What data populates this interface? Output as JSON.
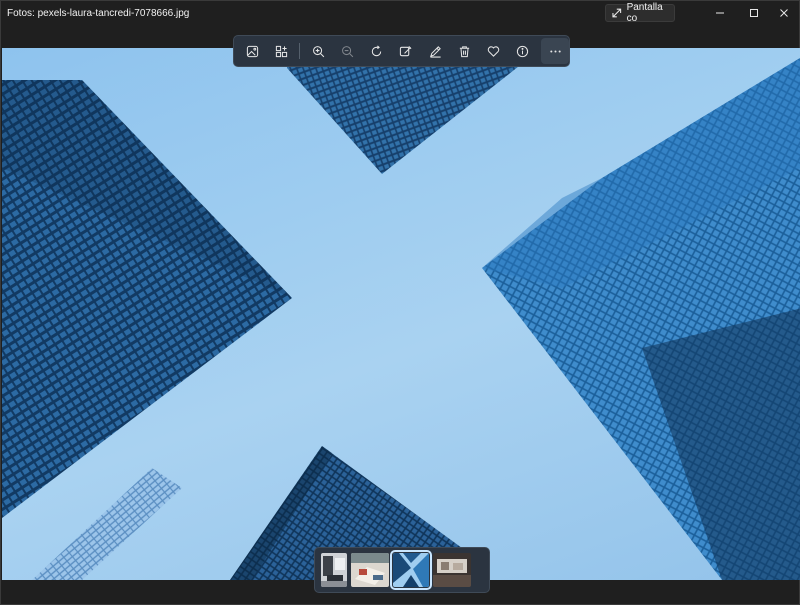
{
  "window": {
    "title": "Fotos: pexels-laura-tancredi-7078666.jpg",
    "fullscreen_label": "Pantalla co",
    "controls": [
      "minimize-icon",
      "maximize-icon",
      "close-icon"
    ]
  },
  "toolbar": {
    "items": [
      {
        "icon": "image-icon"
      },
      {
        "icon": "gallery-add-icon"
      },
      {
        "icon": "zoom-in-icon"
      },
      {
        "icon": "zoom-out-icon",
        "disabled": true
      },
      {
        "icon": "rotate-icon"
      },
      {
        "icon": "edit-image-icon"
      },
      {
        "icon": "draw-icon"
      },
      {
        "icon": "delete-icon"
      },
      {
        "icon": "favorite-icon"
      },
      {
        "icon": "info-icon"
      },
      {
        "icon": "more-icon"
      }
    ]
  },
  "filmstrip": {
    "thumbnails": [
      {
        "name": "thumb-office",
        "selected": false
      },
      {
        "name": "thumb-desk",
        "selected": false
      },
      {
        "name": "thumb-buildings",
        "selected": true
      },
      {
        "name": "thumb-room",
        "selected": false
      }
    ]
  },
  "colors": {
    "background": "#1f1f1f",
    "toolbar": "#2b3440",
    "sky": "#9fcdf0",
    "glass": "#1d4f7e"
  }
}
